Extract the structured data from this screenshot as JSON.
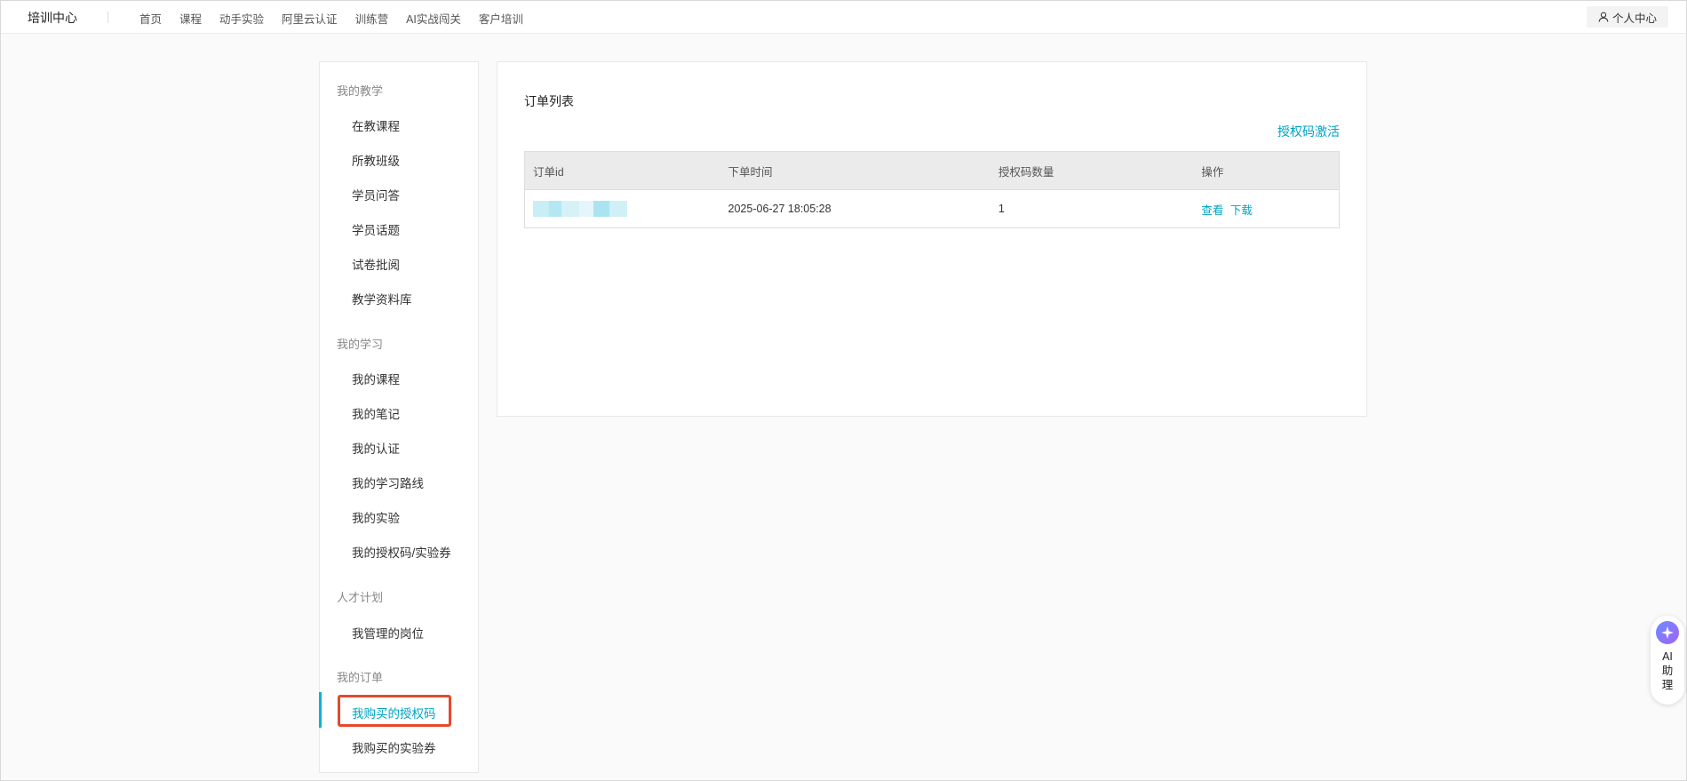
{
  "topnav": {
    "brand": "培训中心",
    "items": [
      "首页",
      "课程",
      "动手实验",
      "阿里云认证",
      "训练营",
      "AI实战闯关",
      "客户培训"
    ],
    "user_center": "个人中心",
    "user_icon": "user-icon"
  },
  "sidebar": {
    "groups": [
      {
        "title": "我的教学",
        "items": [
          "在教课程",
          "所教班级",
          "学员问答",
          "学员话题",
          "试卷批阅",
          "教学资料库"
        ]
      },
      {
        "title": "我的学习",
        "items": [
          "我的课程",
          "我的笔记",
          "我的认证",
          "我的学习路线",
          "我的实验",
          "我的授权码/实验券"
        ]
      },
      {
        "title": "人才计划",
        "items": [
          "我管理的岗位"
        ]
      },
      {
        "title": "我的订单",
        "items": [
          "我购买的授权码",
          "我购买的实验券"
        ]
      }
    ],
    "active_item": "我购买的授权码",
    "active_color": "#00a3c4"
  },
  "main": {
    "title": "订单列表",
    "activate_link": "授权码激活",
    "table": {
      "headers": [
        "订单id",
        "下单时间",
        "授权码数量",
        "操作"
      ],
      "rows": [
        {
          "order_id": "",
          "time": "2025-06-27 18:05:28",
          "count": "1",
          "actions": [
            "查看",
            "下载"
          ]
        }
      ]
    }
  },
  "ai_assistant": {
    "label": "AI助理",
    "icon": "ai-sparkle-icon"
  },
  "colors": {
    "accent": "#00a3c4",
    "highlight_border": "#e5492d"
  }
}
